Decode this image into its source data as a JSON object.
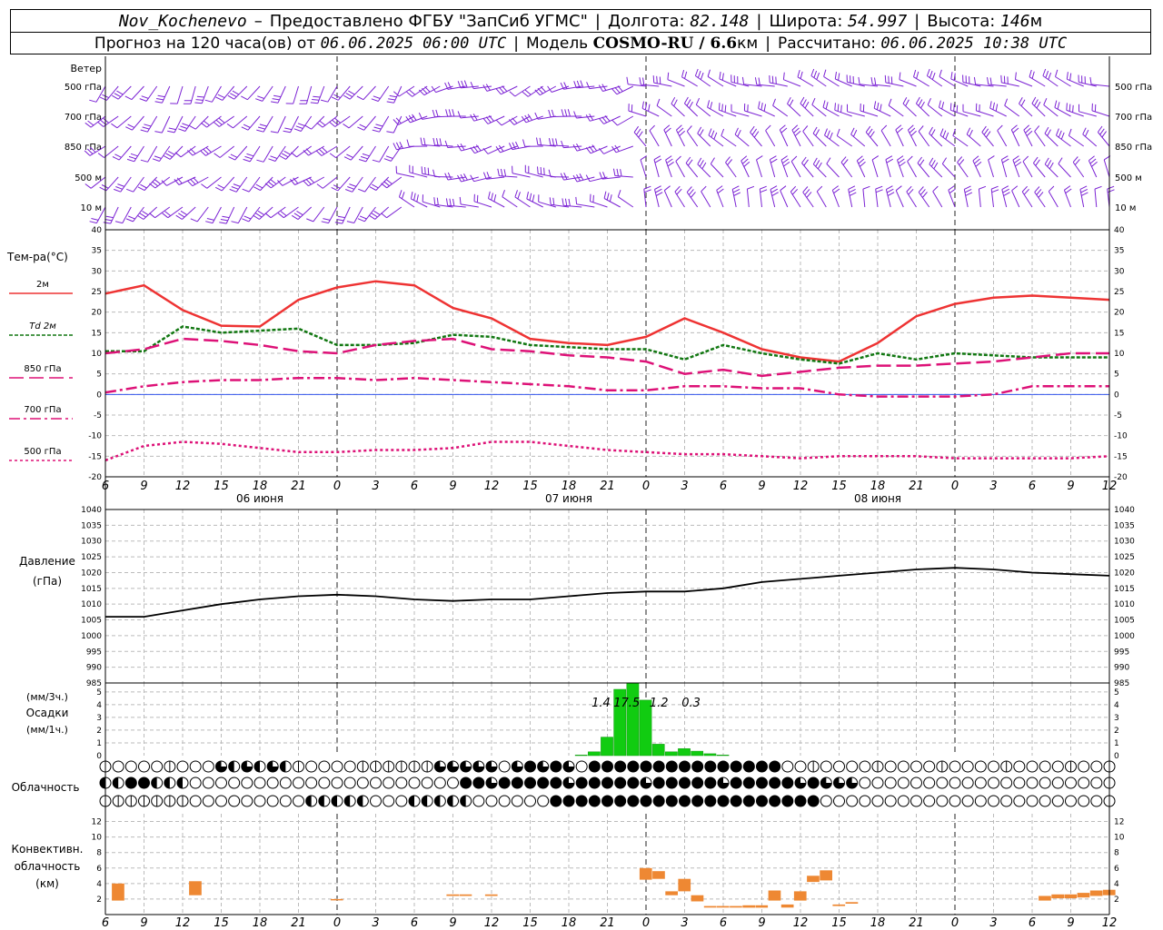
{
  "header": {
    "station": "Nov_Kochenevo",
    "dash": "–",
    "provider": "Предоставлено ФГБУ \"ЗапСиб УГМС\"",
    "lon_label": "Долгота:",
    "lon": "82.148",
    "lat_label": "Широта:",
    "lat": "54.997",
    "alt_label": "Высота:",
    "alt": "146",
    "alt_unit": "м",
    "forecast_label": "Прогноз на 120 часа(ов) от",
    "start_time": "06.06.2025 06:00 UTC",
    "model_label": "Модель",
    "model": "COSMO-RU / 6.6",
    "model_unit": "км",
    "computed_label": "Рассчитано:",
    "computed_time": "06.06.2025 10:38 UTC"
  },
  "chart_data": [
    {
      "type": "wind-barbs",
      "panel_title": "Ветер",
      "levels": [
        "500 гПа",
        "700 гПа",
        "850 гПа",
        "500 м",
        "10 м"
      ],
      "color": "#7b22d4"
    },
    {
      "type": "line",
      "ylabel": "Тем-ра(°C)",
      "ylim": [
        -20,
        40
      ],
      "yticks": [
        -20,
        -15,
        -10,
        -5,
        0,
        5,
        10,
        15,
        20,
        25,
        30,
        35,
        40
      ],
      "hours": [
        0,
        3,
        6,
        9,
        12,
        15,
        18,
        21,
        24,
        27,
        30,
        33,
        36,
        39,
        42,
        45,
        48,
        51,
        54,
        57,
        60,
        63,
        66,
        69,
        72,
        75,
        78
      ],
      "series": [
        {
          "name": "2м",
          "color": "#ee3333",
          "dash": "",
          "values": [
            24.5,
            26.5,
            20.5,
            16.7,
            16.5,
            23,
            26,
            27.5,
            26.5,
            21,
            18.5,
            13.5,
            12.5,
            12,
            14,
            18.5,
            15,
            11,
            9,
            8,
            12.5,
            19,
            22,
            23.5,
            24,
            23.5,
            23
          ]
        },
        {
          "name": "Td 2м",
          "color": "#117711",
          "dash": "4,2",
          "values": [
            10.5,
            10.5,
            16.5,
            15,
            15.5,
            16,
            12,
            12,
            12.5,
            14.5,
            14,
            12,
            11.5,
            11,
            11,
            8.5,
            12,
            10,
            8.5,
            7.5,
            10,
            8.5,
            10,
            9.5,
            9,
            9,
            9
          ]
        },
        {
          "name": "850 гПа",
          "color": "#dd1177",
          "dash": "16,6",
          "values": [
            10,
            11,
            13.5,
            13,
            12,
            10.5,
            10,
            12,
            13,
            13.5,
            11,
            10.5,
            9.5,
            9,
            8,
            5,
            6,
            4.5,
            5.5,
            6.5,
            7,
            7,
            7.5,
            8,
            9,
            10,
            10
          ]
        },
        {
          "name": "700 гПа",
          "color": "#dd1177",
          "dash": "12,4,3,4",
          "values": [
            0.5,
            2,
            3,
            3.5,
            3.5,
            4,
            4,
            3.5,
            4,
            3.5,
            3,
            2.5,
            2,
            1,
            1,
            2,
            2,
            1.5,
            1.5,
            0,
            -0.5,
            -0.5,
            -0.5,
            0,
            2,
            2,
            2
          ]
        },
        {
          "name": "500 гПа",
          "color": "#dd1177",
          "dash": "3,3",
          "values": [
            -16,
            -12.5,
            -11.5,
            -12,
            -13,
            -14,
            -14,
            -13.5,
            -13.5,
            -13,
            -11.5,
            -11.5,
            -12.5,
            -13.5,
            -14,
            -14.5,
            -14.5,
            -15,
            -15.5,
            -15,
            -15,
            -15,
            -15.5,
            -15.5,
            -15.5,
            -15.5,
            -15
          ]
        }
      ],
      "x_hour_ticks": [
        "6",
        "9",
        "12",
        "15",
        "18",
        "21",
        "0",
        "3",
        "6",
        "9",
        "12",
        "15",
        "18",
        "21",
        "0",
        "3",
        "6",
        "9",
        "12",
        "15",
        "18",
        "21",
        "0",
        "3",
        "6",
        "9",
        "12"
      ],
      "x_day_labels": [
        "06 июня",
        "07 июня",
        "08 июня"
      ]
    },
    {
      "type": "line",
      "ylabel": "Давление",
      "yunit": "(гПа)",
      "ylim": [
        985,
        1040
      ],
      "yticks": [
        985,
        990,
        995,
        1000,
        1005,
        1010,
        1015,
        1020,
        1025,
        1030,
        1035,
        1040
      ],
      "hours": [
        0,
        3,
        6,
        9,
        12,
        15,
        18,
        21,
        24,
        27,
        30,
        33,
        36,
        39,
        42,
        45,
        48,
        51,
        54,
        57,
        60,
        63,
        66,
        69,
        72,
        75,
        78
      ],
      "series": [
        {
          "color": "#000000",
          "values": [
            1006,
            1006,
            1008,
            1010,
            1011.5,
            1012.5,
            1013,
            1012.5,
            1011.5,
            1011,
            1011.5,
            1011.5,
            1012.5,
            1013.5,
            1014,
            1014,
            1015,
            1017,
            1018,
            1019,
            1020,
            1021,
            1021.5,
            1021,
            1020,
            1019.5,
            1019
          ]
        }
      ]
    },
    {
      "type": "bar",
      "ylabel": "(мм/3ч.)",
      "title": "Осадки",
      "yunit": "(мм/1ч.)",
      "ylim": [
        0,
        5.7
      ],
      "yticks": [
        0,
        1,
        2,
        3,
        4,
        5
      ],
      "hours": [
        37,
        38,
        39,
        40,
        41,
        42,
        43,
        44,
        45,
        46,
        47,
        48
      ],
      "values": [
        0.05,
        0.3,
        1.45,
        5.2,
        5.7,
        4.35,
        0.9,
        0.3,
        0.55,
        0.35,
        0.15,
        0.05
      ],
      "color": "#11cc11",
      "annotations": [
        "1.4",
        "17.5",
        "1.2",
        "0.3"
      ]
    },
    {
      "type": "symbols",
      "title": "Облачность",
      "rows": 3
    },
    {
      "type": "bar",
      "ylabel": "Конвективн.",
      "ylabel2": "облачность",
      "yunit": "(км)",
      "ylim": [
        0,
        13
      ],
      "yticks": [
        0,
        2,
        4,
        6,
        8,
        10,
        12
      ],
      "bars": [
        {
          "h": 1,
          "bottom": 1.8,
          "top": 4.0
        },
        {
          "h": 7,
          "bottom": 2.5,
          "top": 4.3
        },
        {
          "h": 18,
          "bottom": 1.9,
          "top": 2.0
        },
        {
          "h": 27,
          "bottom": 2.4,
          "top": 2.6
        },
        {
          "h": 28,
          "bottom": 2.4,
          "top": 2.6
        },
        {
          "h": 30,
          "bottom": 2.4,
          "top": 2.6
        },
        {
          "h": 42,
          "bottom": 4.5,
          "top": 6.0
        },
        {
          "h": 43,
          "bottom": 4.6,
          "top": 5.6
        },
        {
          "h": 44,
          "bottom": 2.5,
          "top": 3.0
        },
        {
          "h": 45,
          "bottom": 3.0,
          "top": 4.6
        },
        {
          "h": 46,
          "bottom": 1.7,
          "top": 2.5
        },
        {
          "h": 47,
          "bottom": 0.9,
          "top": 1.1
        },
        {
          "h": 48,
          "bottom": 0.9,
          "top": 1.1
        },
        {
          "h": 49,
          "bottom": 0.9,
          "top": 1.1
        },
        {
          "h": 50,
          "bottom": 0.9,
          "top": 1.2
        },
        {
          "h": 51,
          "bottom": 0.9,
          "top": 1.2
        },
        {
          "h": 52,
          "bottom": 1.8,
          "top": 3.1
        },
        {
          "h": 53,
          "bottom": 0.9,
          "top": 1.3
        },
        {
          "h": 54,
          "bottom": 1.8,
          "top": 3.0
        },
        {
          "h": 55,
          "bottom": 4.2,
          "top": 5.0
        },
        {
          "h": 56,
          "bottom": 4.4,
          "top": 5.7
        },
        {
          "h": 57,
          "bottom": 1.1,
          "top": 1.3
        },
        {
          "h": 58,
          "bottom": 1.4,
          "top": 1.6
        },
        {
          "h": 73,
          "bottom": 1.8,
          "top": 2.4
        },
        {
          "h": 74,
          "bottom": 2.1,
          "top": 2.6
        },
        {
          "h": 75,
          "bottom": 2.1,
          "top": 2.6
        },
        {
          "h": 76,
          "bottom": 2.2,
          "top": 2.8
        },
        {
          "h": 77,
          "bottom": 2.4,
          "top": 3.1
        },
        {
          "h": 78,
          "bottom": 2.5,
          "top": 3.2
        }
      ],
      "color": "#ee8833"
    }
  ]
}
